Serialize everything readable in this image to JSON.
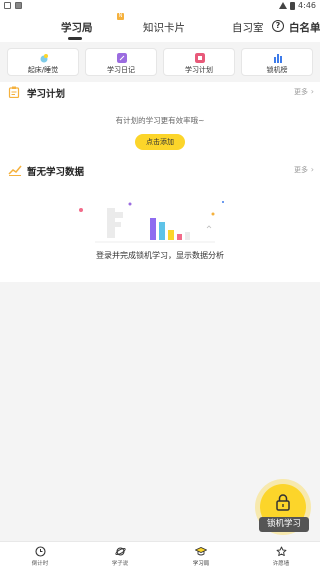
{
  "status_bar": {
    "time": "4:46"
  },
  "top_nav": {
    "tabs": [
      {
        "label": "学习局",
        "badge": "N"
      },
      {
        "label": "知识卡片"
      },
      {
        "label": "自习室"
      }
    ],
    "whitelist_label": "白名单"
  },
  "features": [
    {
      "label": "起床/睡觉",
      "icon": "wake-sleep-icon"
    },
    {
      "label": "学习日记",
      "icon": "diary-icon"
    },
    {
      "label": "学习计划",
      "icon": "plan-icon"
    },
    {
      "label": "锁机榜",
      "icon": "ranking-icon"
    }
  ],
  "study_plan": {
    "title": "学习计划",
    "more": "更多",
    "hint": "有计划的学习更有效率哦~",
    "button": "点击添加"
  },
  "study_data": {
    "title": "暂无学习数据",
    "more": "更多",
    "empty_text": "登录并完成锁机学习，显示数据分析"
  },
  "fab": {
    "label": "锁机学习"
  },
  "bottom_nav": [
    {
      "label": "倒计时",
      "icon": "clock-icon"
    },
    {
      "label": "学子说",
      "icon": "planet-icon"
    },
    {
      "label": "学习局",
      "icon": "grad-cap-icon"
    },
    {
      "label": "许愿墙",
      "icon": "star-icon"
    }
  ],
  "colors": {
    "accent": "#fcd52a",
    "diary": "#9b6ce0",
    "plan": "#e85a7a",
    "ranking": "#3d7bea"
  }
}
